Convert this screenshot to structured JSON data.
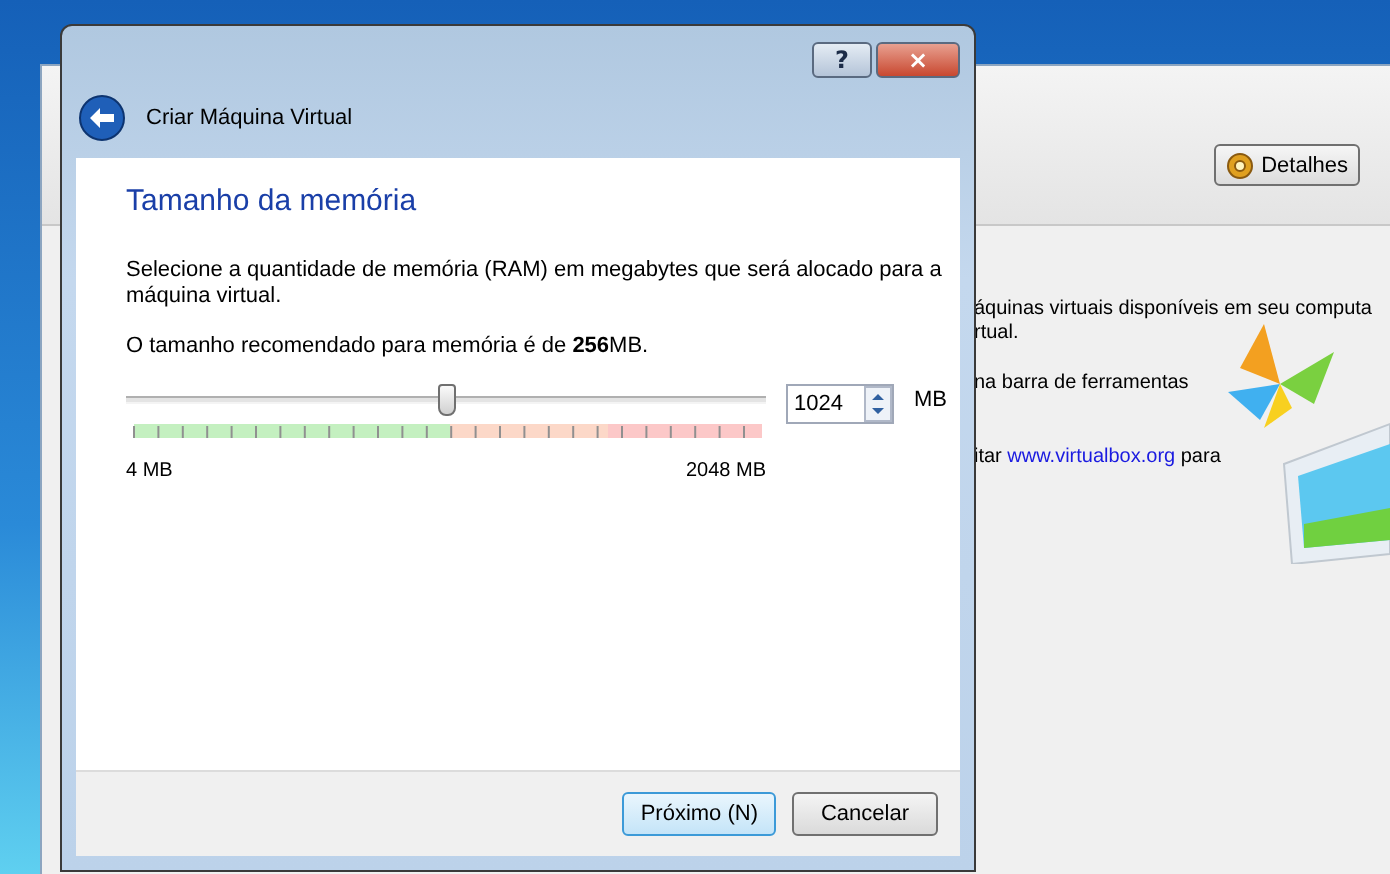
{
  "background_window": {
    "toolbar": {
      "details_button": "Detalhes"
    },
    "text_lines": [
      {
        "kind": "text",
        "text": "áquinas virtuais disponíveis em seu computa"
      },
      {
        "kind": "text",
        "text": "rtual."
      },
      {
        "kind": "text",
        "text": "na barra de ferramentas"
      },
      {
        "kind": "link",
        "before": "itar ",
        "link": "www.virtualbox.org",
        "after": " para"
      }
    ]
  },
  "dialog": {
    "title_buttons": [
      "?",
      "×"
    ],
    "title": "Criar Máquina Virtual",
    "heading": "Tamanho da memória",
    "description": "Selecione a quantidade de memória (RAM) em megabytes que será alocado para a máquina virtual.",
    "recommendation": "O tamanho recomendado para memória é de **256**MB.",
    "slider": {
      "level": 0.5,
      "min_label": "4 MB",
      "max_label": "2048 MB"
    },
    "memory_field": {
      "value": "1024",
      "unit": "MB"
    },
    "buttons": [
      {
        "label": "Próximo (N)",
        "selected": true
      },
      {
        "label": "Cancelar",
        "selected": false
      }
    ]
  }
}
